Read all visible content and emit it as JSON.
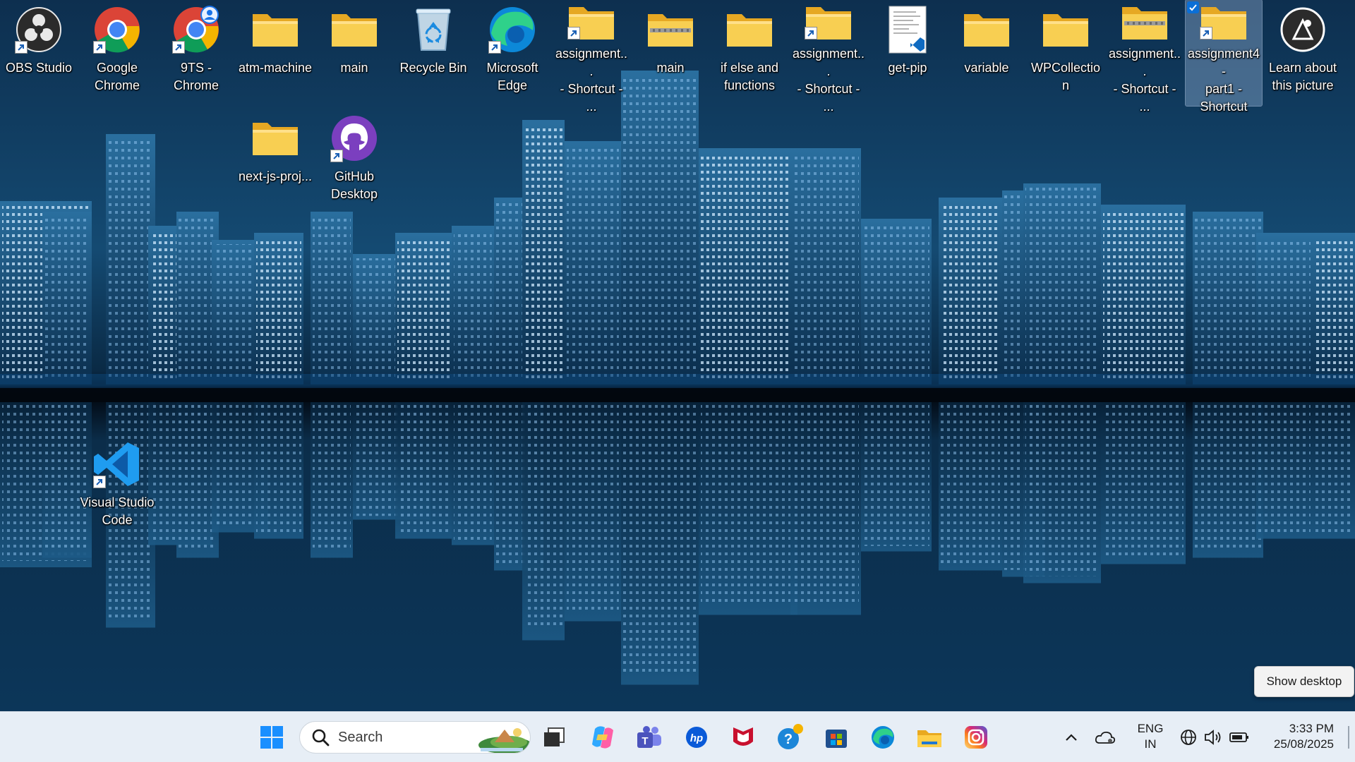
{
  "desktop": {
    "icons": [
      {
        "label": "OBS Studio",
        "icon": "obs-icon",
        "shortcut": true
      },
      {
        "label": "Google\nChrome",
        "icon": "chrome-icon",
        "shortcut": true
      },
      {
        "label": "9TS -\nChrome",
        "icon": "chrome-profile-icon",
        "shortcut": true
      },
      {
        "label": "atm-machine",
        "icon": "folder-icon",
        "shortcut": false
      },
      {
        "label": "main",
        "icon": "folder-icon",
        "shortcut": false
      },
      {
        "label": "Recycle Bin",
        "icon": "recycle-bin-icon",
        "shortcut": false
      },
      {
        "label": "Microsoft\nEdge",
        "icon": "edge-icon",
        "shortcut": true
      },
      {
        "label": "assignment...\n- Shortcut - ...",
        "icon": "folder-icon",
        "shortcut": true
      },
      {
        "label": "main",
        "icon": "zip-folder-icon",
        "shortcut": false
      },
      {
        "label": "if else and\nfunctions",
        "icon": "folder-icon",
        "shortcut": false
      },
      {
        "label": "assignment...\n- Shortcut - ...",
        "icon": "folder-icon",
        "shortcut": true
      },
      {
        "label": "get-pip",
        "icon": "python-file-icon",
        "shortcut": false
      },
      {
        "label": "variable",
        "icon": "folder-icon",
        "shortcut": false
      },
      {
        "label": "WPCollection",
        "icon": "folder-icon",
        "shortcut": false
      },
      {
        "label": "assignment...\n- Shortcut - ...",
        "icon": "zip-folder-icon",
        "shortcut": false
      },
      {
        "label": "assignment4-\npart1 -\nShortcut",
        "icon": "folder-icon",
        "shortcut": true,
        "selected": true
      },
      {
        "label": "Learn about\nthis picture",
        "icon": "learn-picture-icon",
        "shortcut": false
      },
      {
        "label": "next-js-proj...",
        "icon": "folder-icon",
        "shortcut": false
      },
      {
        "label": "GitHub\nDesktop",
        "icon": "github-icon",
        "shortcut": true
      },
      {
        "label": "Visual Studio\nCode",
        "icon": "vscode-icon",
        "shortcut": true
      }
    ]
  },
  "tooltip": {
    "text": "Show desktop"
  },
  "taskbar": {
    "search_placeholder": "Search",
    "pinned": [
      {
        "name": "start-button",
        "icon": "windows-icon"
      },
      {
        "name": "task-view-button",
        "icon": "task-view-icon"
      },
      {
        "name": "copilot-button",
        "icon": "copilot-icon"
      },
      {
        "name": "teams-button",
        "icon": "teams-icon"
      },
      {
        "name": "hp-button",
        "icon": "hp-icon"
      },
      {
        "name": "mcafee-button",
        "icon": "mcafee-icon"
      },
      {
        "name": "get-help-button",
        "icon": "help-icon"
      },
      {
        "name": "store-button",
        "icon": "store-icon"
      },
      {
        "name": "edge-button",
        "icon": "edge-icon"
      },
      {
        "name": "file-explorer-button",
        "icon": "folder-icon"
      },
      {
        "name": "instagram-button",
        "icon": "instagram-icon"
      }
    ],
    "tray": {
      "language_line1": "ENG",
      "language_line2": "IN",
      "time": "3:33 PM",
      "date": "25/08/2025"
    }
  },
  "colors": {
    "accent": "#0b6fd6",
    "taskbar_bg": "#e7eef6",
    "folder_yellow": "#f5c84a"
  }
}
